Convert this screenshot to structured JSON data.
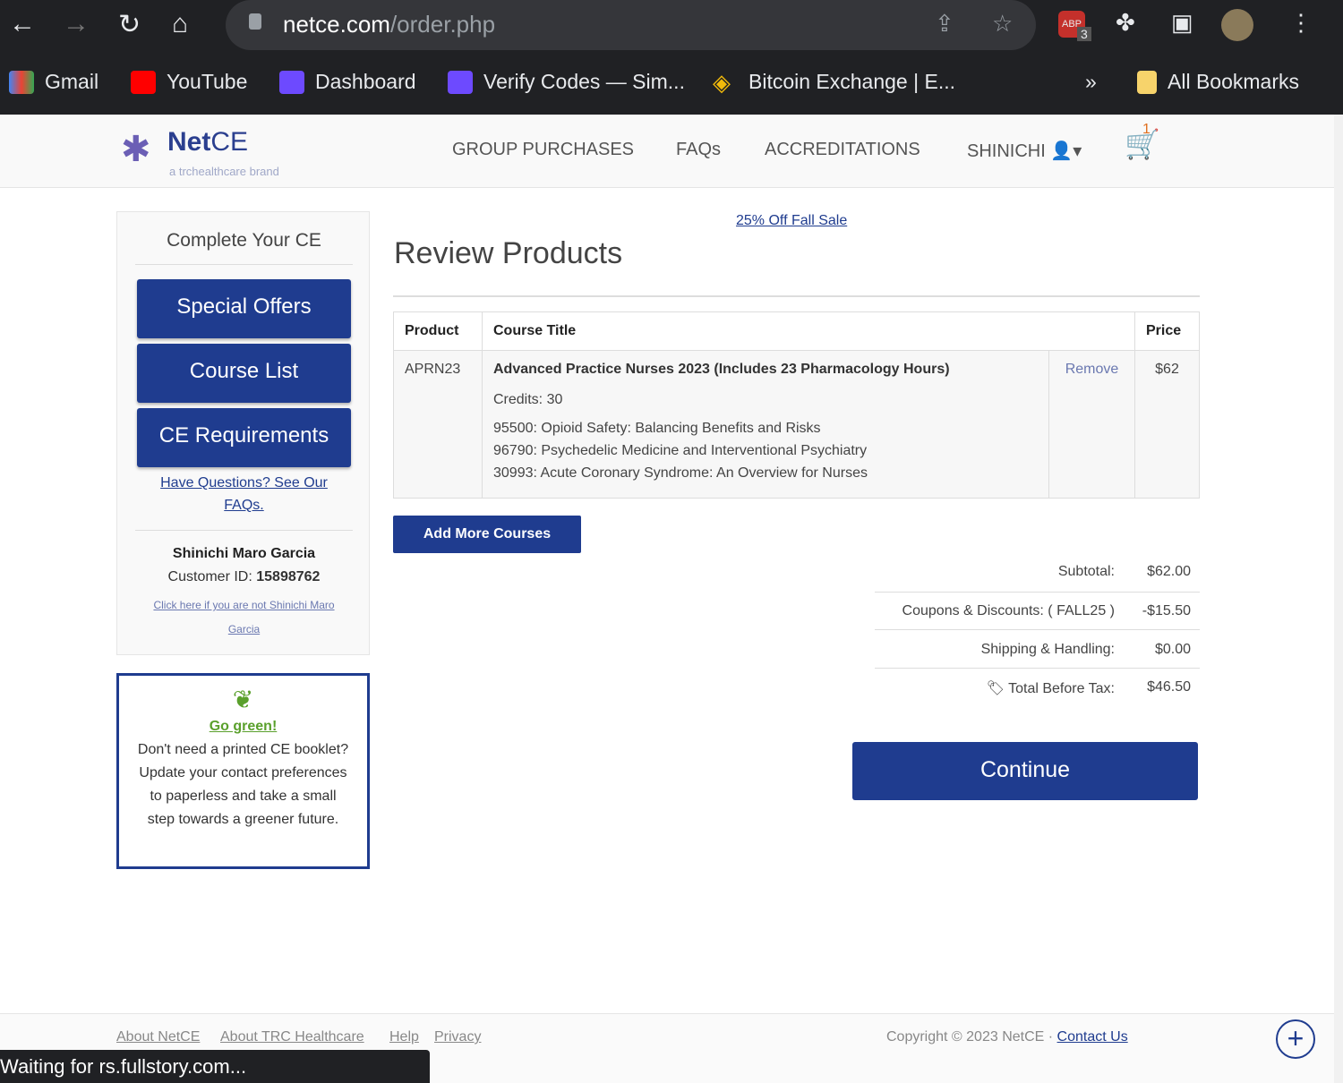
{
  "browser": {
    "url_host": "netce.com",
    "url_path": "/order.php",
    "abp_count": "3",
    "bookmarks": [
      {
        "label": "Gmail"
      },
      {
        "label": "YouTube"
      },
      {
        "label": "Dashboard"
      },
      {
        "label": "Verify Codes — Sim..."
      },
      {
        "label": "Bitcoin Exchange | E..."
      }
    ],
    "more": "»",
    "all_bookmarks": "All Bookmarks"
  },
  "header": {
    "logo_name": "Net",
    "logo_name2": "CE",
    "tagline": "a trchealthcare brand",
    "nav": [
      "GROUP PURCHASES",
      "FAQs",
      "ACCREDITATIONS",
      "SHINICHI"
    ],
    "cart_count": "1"
  },
  "sidebar": {
    "title": "Complete Your CE",
    "buttons": [
      "Special Offers",
      "Course List",
      "CE Requirements"
    ],
    "faq_link": "Have Questions? See Our FAQs.",
    "user_name": "Shinichi Maro Garcia",
    "customer_id_label": "Customer ID:",
    "customer_id": "15898762",
    "not_you_link": "Click here if you are not Shinichi Maro Garcia"
  },
  "green": {
    "link": "Go green!",
    "text": "Don't need a printed CE booklet? Update your contact preferences to paperless and take a small step towards a greener future."
  },
  "main": {
    "promo": "25% Off Fall Sale",
    "title": "Review Products",
    "table": {
      "headers": [
        "Product",
        "Course Title",
        "",
        "Price"
      ],
      "row": {
        "product": "APRN23",
        "title": "Advanced Practice Nurses 2023 (Includes 23 Pharmacology Hours)",
        "credits": "Credits: 30",
        "courses": [
          "95500: Opioid Safety: Balancing Benefits and Risks",
          "96790: Psychedelic Medicine and Interventional Psychiatry",
          "30993: Acute Coronary Syndrome: An Overview for Nurses"
        ],
        "remove": "Remove",
        "price": "$62"
      }
    },
    "add_more": "Add More Courses",
    "summary": [
      {
        "label": "Subtotal:",
        "value": "$62.00"
      },
      {
        "label": "Coupons & Discounts: ( FALL25 )",
        "value": "-$15.50"
      },
      {
        "label": "Shipping & Handling:",
        "value": "$0.00"
      },
      {
        "label": "Total Before Tax:",
        "value": "$46.50"
      }
    ],
    "continue": "Continue"
  },
  "footer": {
    "links": [
      "About NetCE",
      "About TRC Healthcare",
      "Help",
      "Privacy"
    ],
    "copyright": "Copyright © 2023 NetCE ·",
    "contact": "Contact Us"
  },
  "status": "Waiting for rs.fullstory.com..."
}
